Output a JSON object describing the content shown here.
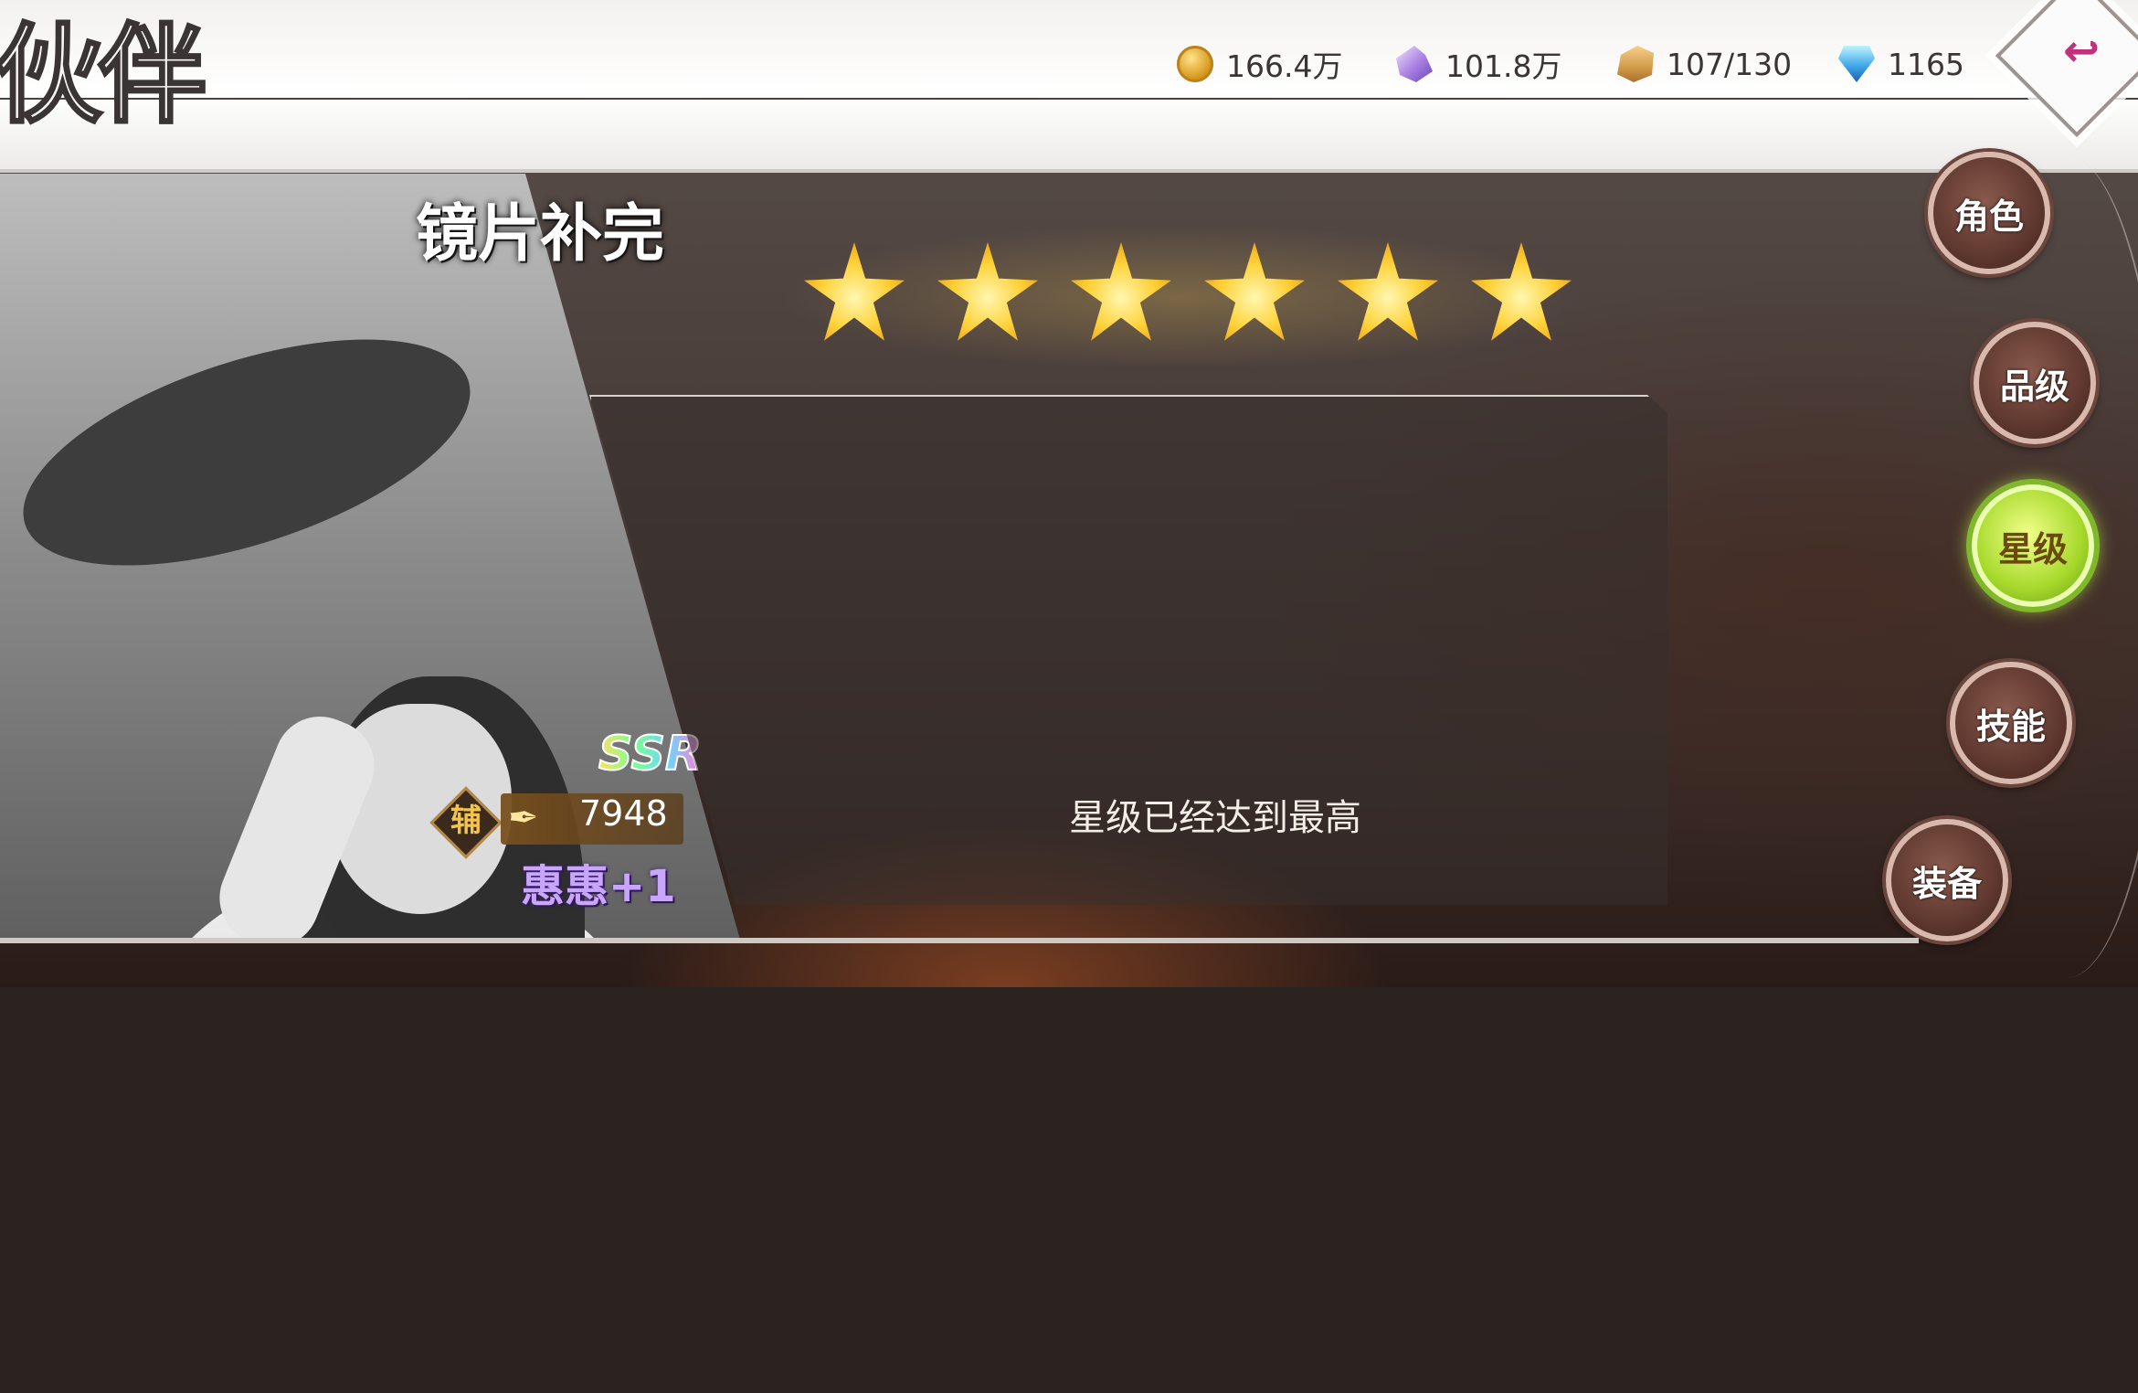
{
  "header": {
    "title": "伙伴",
    "resources": [
      {
        "icon": "coin-icon",
        "value": "166.4万"
      },
      {
        "icon": "crystal-icon",
        "value": "101.8万"
      },
      {
        "icon": "box-icon",
        "value": "107/130"
      },
      {
        "icon": "gem-icon",
        "value": "1165"
      }
    ],
    "back_icon": "↩"
  },
  "character": {
    "panel_title": "镜片补完",
    "rarity": "SSR",
    "role": "辅",
    "power_icon": "✒",
    "power": "7948",
    "name": "惠惠+1"
  },
  "stars": {
    "count": 6,
    "color": "#ffd23a"
  },
  "message": "星级已经达到最高",
  "nav": [
    {
      "label": "角色",
      "active": false
    },
    {
      "label": "品级",
      "active": false
    },
    {
      "label": "星级",
      "active": true
    },
    {
      "label": "技能",
      "active": false
    },
    {
      "label": "装备",
      "active": false
    }
  ],
  "colors": {
    "accent": "#a6d92b",
    "name": "#c8a6ff",
    "back": "#c2317c"
  }
}
